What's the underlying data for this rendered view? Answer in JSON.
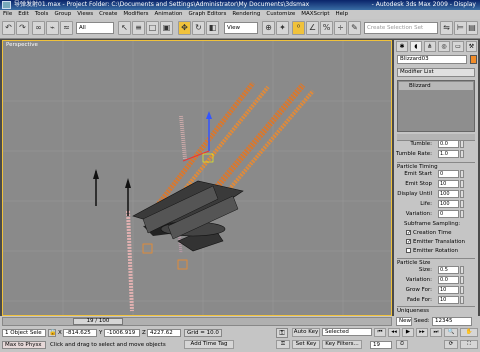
{
  "titlebar": {
    "text": "导弹发射01.max    - Project Folder: C:\\Documents and Settings\\Administrator\\My Documents\\3dsmax",
    "right": "- Autodesk 3ds Max 2009        - Display"
  },
  "menu": [
    "File",
    "Edit",
    "Tools",
    "Group",
    "Views",
    "Create",
    "Modifiers",
    "Animation",
    "Graph Editors",
    "Rendering",
    "Customize",
    "MAXScript",
    "Help"
  ],
  "toolbar": {
    "filter_value": "All",
    "view_value": "View",
    "selection_set_placeholder": "Create Selection Set"
  },
  "viewport": {
    "label": "Perspective"
  },
  "command_panel": {
    "object_name": "Blizzard03",
    "modifier_list": "Modifier List",
    "stack_item": "Blizzard",
    "tumble_label": "Tumble:",
    "tumble_value": "0.0",
    "tumble_rate_label": "Tumble Rate:",
    "tumble_rate_value": "1.0",
    "particle_timing_title": "Particle Timing",
    "emit_start_label": "Emit Start",
    "emit_start_value": "0",
    "emit_stop_label": "Emit Stop",
    "emit_stop_value": "10",
    "display_until_label": "Display Until",
    "display_until_value": "100",
    "life_label": "Life:",
    "life_value": "100",
    "variation_label": "Variation:",
    "variation_value": "0",
    "subframe_title": "Subframe Sampling:",
    "creation_time": "Creation Time",
    "emitter_translation": "Emitter Translation",
    "emitter_rotation": "Emitter Rotation",
    "particle_size_title": "Particle Size",
    "size_label": "Size:",
    "size_value": "0.5",
    "size_variation_label": "Variation:",
    "size_variation_value": "0.0",
    "grow_for_label": "Grow For:",
    "grow_for_value": "10",
    "fade_for_label": "Fade For:",
    "fade_for_value": "10",
    "uniqueness_title": "Uniqueness",
    "new_label": "New",
    "seed_label": "Seed:",
    "seed_value": "12345"
  },
  "bottom": {
    "time_slider": "19 / 100",
    "object_selected": "1 Object Sele",
    "x_label": "X",
    "x_value": "-814.625",
    "y_label": "Y",
    "y_value": "-1006.919",
    "z_label": "Z",
    "z_value": "4227.62",
    "grid": "Grid = 10.0",
    "auto_key": "Auto Key",
    "selected": "Selected",
    "set_key": "Set Key",
    "key_filters": "Key Filters...",
    "status_prompt": "Click and drag to select and move objects",
    "add_time_tag": "Add Time Tag",
    "frame_value": "19",
    "max_to_physx": "Max to Physx"
  }
}
